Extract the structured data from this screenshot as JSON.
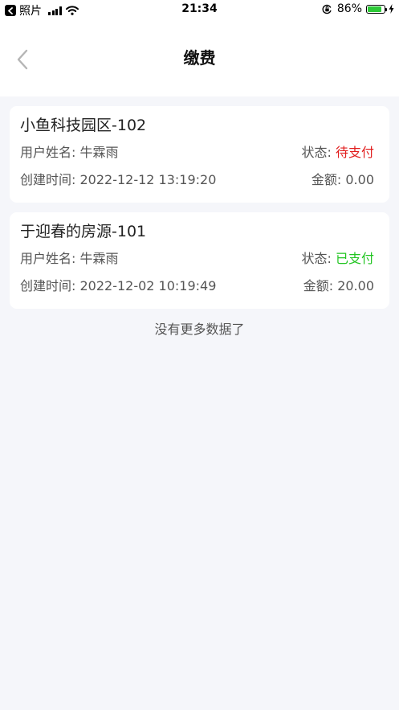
{
  "status_bar": {
    "back_app": "照片",
    "time": "21:34",
    "battery": "86%"
  },
  "nav": {
    "title": "缴费"
  },
  "records": [
    {
      "title": "小鱼科技园区-102",
      "user_label": "用户姓名: ",
      "user_name": "牛霖雨",
      "status_label": "状态: ",
      "status_value": "待支付",
      "created_label": "创建时间: ",
      "created_time": "2022-12-12 13:19:20",
      "amount_label": "金额: ",
      "amount_value": "0.00"
    },
    {
      "title": "于迎春的房源-101",
      "user_label": "用户姓名: ",
      "user_name": "牛霖雨",
      "status_label": "状态: ",
      "status_value": "已支付",
      "created_label": "创建时间: ",
      "created_time": "2022-12-02 10:19:49",
      "amount_label": "金额: ",
      "amount_value": "20.00"
    }
  ],
  "footer": {
    "no_more": "没有更多数据了"
  },
  "colors": {
    "pending": "#e11d1d",
    "paid": "#21c521",
    "background": "#f5f6fa",
    "battery": "#2dc937"
  },
  "icons": [
    "back-app-icon",
    "signal-icon",
    "wifi-icon",
    "lock-rotation-icon",
    "battery-icon",
    "charge-icon",
    "back-chevron-icon"
  ]
}
